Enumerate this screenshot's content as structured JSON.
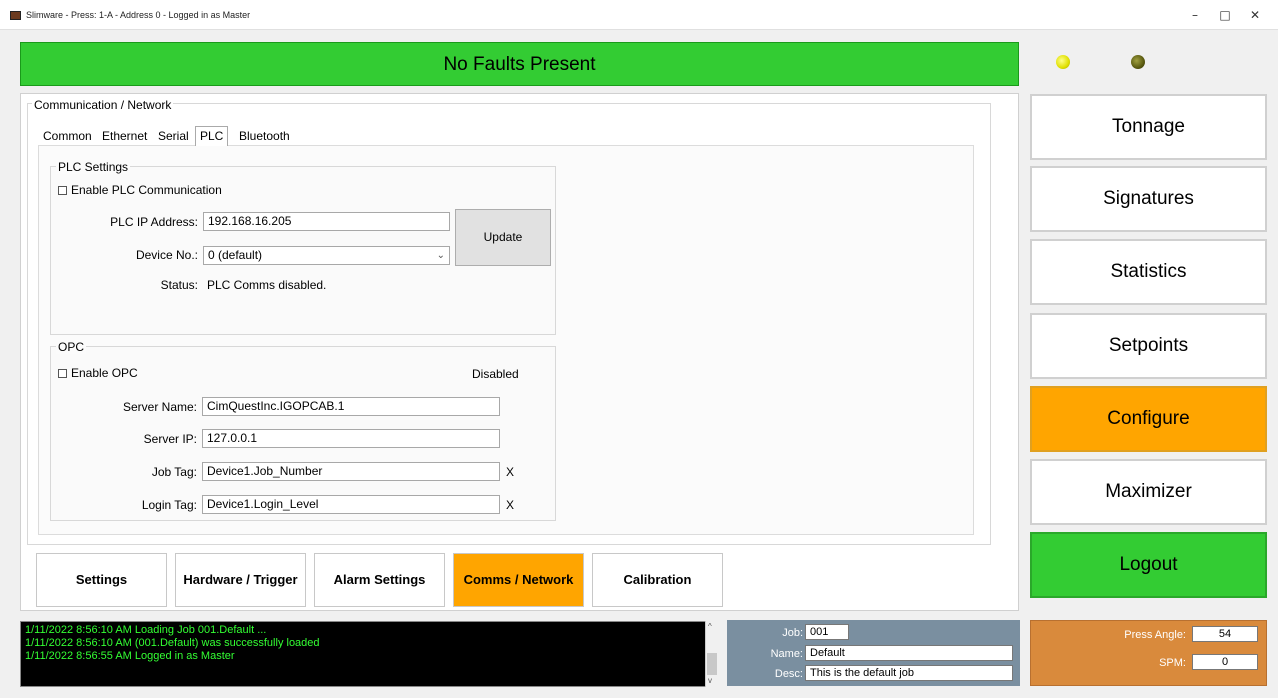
{
  "window": {
    "title": "Slimware - Press: 1-A - Address 0 - Logged in as Master",
    "minimize": "–",
    "maximize": "□",
    "close": "✕"
  },
  "fault_banner": {
    "text": "No Faults Present",
    "color": "#33cc33"
  },
  "comm_group": {
    "title": "Communication / Network"
  },
  "tabs": [
    "Common",
    "Ethernet",
    "Serial",
    "PLC",
    "Bluetooth"
  ],
  "active_tab": "PLC",
  "plc": {
    "title": "PLC Settings",
    "enable_label": "Enable PLC Communication",
    "enabled": false,
    "ip_label": "PLC IP Address:",
    "ip_value": "192.168.16.205",
    "device_label": "Device No.:",
    "device_value": "0 (default)",
    "status_label": "Status:",
    "status_value": "PLC Comms disabled.",
    "update_button": "Update"
  },
  "opc": {
    "title": "OPC",
    "enable_label": "Enable OPC",
    "enabled": false,
    "state_text": "Disabled",
    "server_name_label": "Server Name:",
    "server_name_value": "CimQuestInc.IGOPCAB.1",
    "server_ip_label": "Server IP:",
    "server_ip_value": "127.0.0.1",
    "job_tag_label": "Job Tag:",
    "job_tag_value": "Device1.Job_Number",
    "login_tag_label": "Login Tag:",
    "login_tag_value": "Device1.Login_Level",
    "clear_glyph": "X"
  },
  "bottom_nav": [
    "Settings",
    "Hardware / Trigger",
    "Alarm Settings",
    "Comms / Network",
    "Calibration"
  ],
  "bottom_nav_active": "Comms / Network",
  "menu": [
    "Tonnage",
    "Signatures",
    "Statistics",
    "Setpoints",
    "Configure",
    "Maximizer",
    "Logout"
  ],
  "menu_active": "Configure",
  "log": [
    "1/11/2022 8:56:10 AM  Loading Job 001.Default ...",
    "1/11/2022 8:56:10 AM  (001.Default) was successfully loaded",
    "1/11/2022 8:56:55 AM  Logged in as Master"
  ],
  "job": {
    "job_label": "Job:",
    "job_value": "001",
    "name_label": "Name:",
    "name_value": "Default",
    "desc_label": "Desc:",
    "desc_value": "This is the default job"
  },
  "press": {
    "angle_label": "Press Angle:",
    "angle_value": "54",
    "spm_label": "SPM:",
    "spm_value": "0"
  },
  "colors": {
    "accent_orange": "#ffa500",
    "ok_green": "#33cc33",
    "job_panel": "#7a8fa0",
    "press_panel": "#d98a3c",
    "log_text": "#33ff33"
  }
}
